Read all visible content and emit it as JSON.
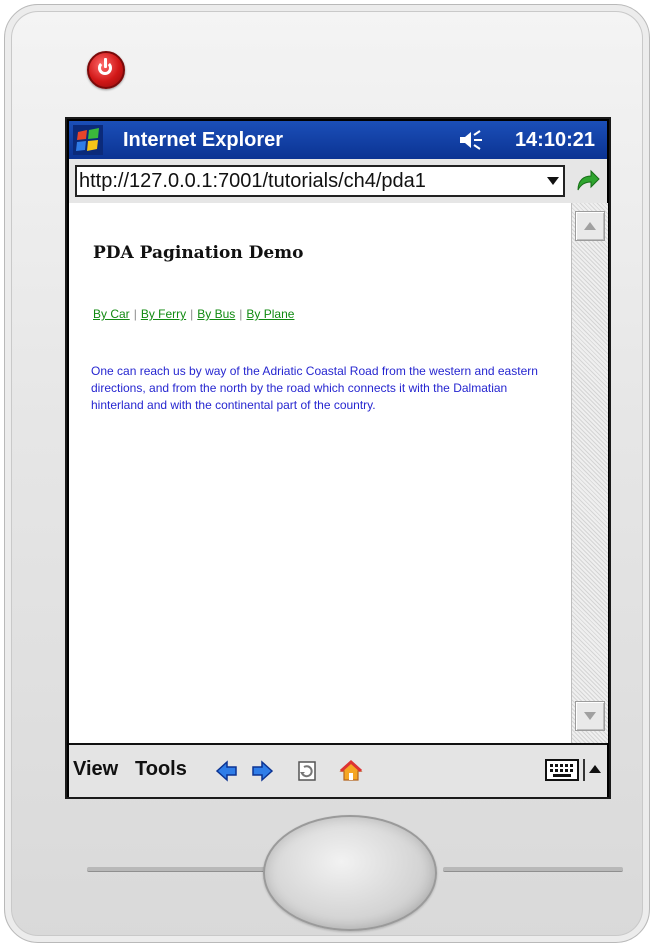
{
  "titlebar": {
    "app_title": "Internet Explorer",
    "time": "14:10:21",
    "logo_icon": "windows-flag-icon",
    "speaker_icon": "speaker-icon"
  },
  "address": {
    "url": "http://127.0.0.1:7001/tutorials/ch4/pda1",
    "go_icon": "go-arrow-icon"
  },
  "page": {
    "heading": "PDA Pagination Demo",
    "links": [
      "By Car",
      "By Ferry",
      "By Bus",
      "By Plane"
    ],
    "separator": "|",
    "body": "One can reach us by way of the Adriatic Coastal Road from the western and eastern directions, and from the north by the road which connects it with the Dalmatian hinterland and with the continental part of the country.",
    "link_color": "#118a11",
    "body_color": "#2626d0"
  },
  "toolbar": {
    "view_label": "View",
    "tools_label": "Tools",
    "icons": [
      "back-icon",
      "forward-icon",
      "refresh-icon",
      "home-icon",
      "keyboard-icon"
    ]
  },
  "colors": {
    "titlebar": "#0b3393",
    "power_button": "#d11717"
  }
}
